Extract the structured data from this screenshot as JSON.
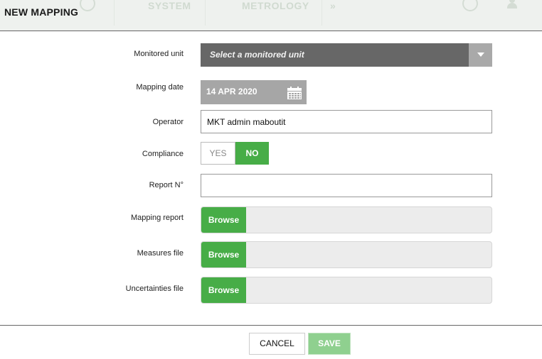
{
  "dialog": {
    "title": "NEW MAPPING"
  },
  "background_nav": {
    "items": [
      "SYSTEM",
      "METROLOGY",
      "»"
    ]
  },
  "form": {
    "monitored_unit": {
      "label": "Monitored unit",
      "placeholder": "Select a monitored unit"
    },
    "mapping_date": {
      "label": "Mapping date",
      "value": "14 APR 2020"
    },
    "operator": {
      "label": "Operator",
      "value": "MKT admin maboutit"
    },
    "compliance": {
      "label": "Compliance",
      "yes": "YES",
      "no": "NO",
      "selected": "NO"
    },
    "report_no": {
      "label": "Report N°",
      "value": ""
    },
    "mapping_report": {
      "label": "Mapping report",
      "browse": "Browse"
    },
    "measures_file": {
      "label": "Measures file",
      "browse": "Browse"
    },
    "uncertainties_file": {
      "label": "Uncertainties file",
      "browse": "Browse"
    }
  },
  "footer": {
    "cancel_label": "CANCEL",
    "save_label": "SAVE"
  },
  "colors": {
    "accent_green": "#47ad47",
    "save_disabled": "#8fd08f",
    "select_bg": "#676767",
    "date_bg": "#a6a6a6"
  },
  "icons": {
    "select_arrow": "chevron-down-icon",
    "date_picker": "calendar-icon"
  }
}
